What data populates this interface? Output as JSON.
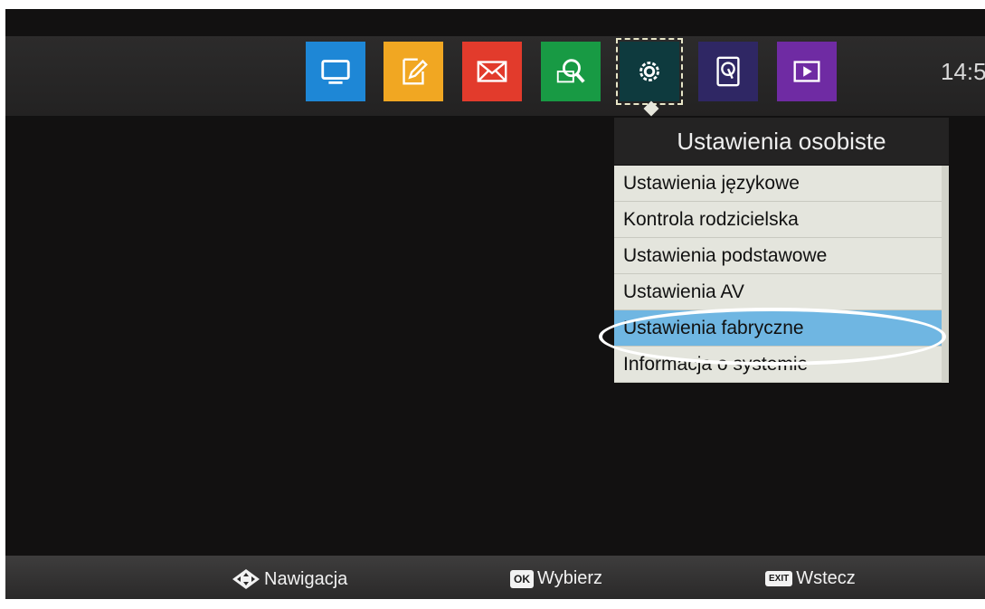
{
  "header": {
    "clock": "14:5",
    "tiles": [
      {
        "icon": "tv-icon",
        "color": "#1e87d6"
      },
      {
        "icon": "edit-icon",
        "color": "#f1a722"
      },
      {
        "icon": "mail-icon",
        "color": "#e23b2c"
      },
      {
        "icon": "search-icon",
        "color": "#189a44"
      },
      {
        "icon": "settings-icon",
        "color": "#0e3a3e",
        "selected": true
      },
      {
        "icon": "storage-icon",
        "color": "#2f2764"
      },
      {
        "icon": "play-icon",
        "color": "#6f2ba3"
      }
    ]
  },
  "menu": {
    "title": "Ustawienia osobiste",
    "items": [
      {
        "label": "Ustawienia językowe"
      },
      {
        "label": "Kontrola rodzicielska"
      },
      {
        "label": "Ustawienia podstawowe"
      },
      {
        "label": "Ustawienia AV"
      },
      {
        "label": "Ustawienia fabryczne",
        "active": true
      },
      {
        "label": "Informacja o systemie"
      }
    ],
    "highlight_color": "#6fb6e2"
  },
  "footer": {
    "nav_label": "Nawigacja",
    "ok_key": "OK",
    "ok_label": "Wybierz",
    "exit_key": "EXIT",
    "exit_label": "Wstecz"
  }
}
